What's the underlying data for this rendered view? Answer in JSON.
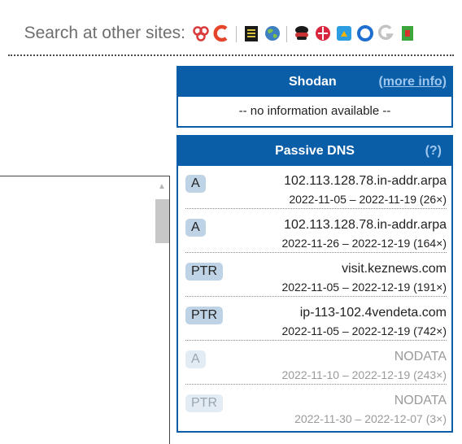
{
  "search": {
    "label": "Search at other sites:",
    "icons": [
      "chain-links-icon",
      "c-logo-icon",
      "document-icon",
      "globe-icon",
      "spy-mask-icon",
      "red-globe-icon",
      "blue-square-icon",
      "blue-ring-icon",
      "grey-g-icon",
      "green-box-icon"
    ]
  },
  "shodan": {
    "title": "Shodan",
    "more_info": "(more info)",
    "message": "-- no information available --"
  },
  "passive_dns": {
    "title": "Passive DNS",
    "help": "(?)",
    "records": [
      {
        "type": "A",
        "name": "102.113.128.78.in-addr.arpa",
        "dates": "2022-11-05 – 2022-11-19 (26×)"
      },
      {
        "type": "A",
        "name": "102.113.128.78.in-addr.arpa",
        "dates": "2022-11-26 – 2022-12-19 (164×)"
      },
      {
        "type": "PTR",
        "name": "visit.keznews.com",
        "dates": "2022-11-05 – 2022-12-19 (191×)"
      },
      {
        "type": "PTR",
        "name": "ip-113-102.4vendeta.com",
        "dates": "2022-11-05 – 2022-12-19 (742×)"
      },
      {
        "type": "A",
        "name": "NODATA",
        "dates": "2022-11-10 – 2022-12-19 (243×)"
      },
      {
        "type": "PTR",
        "name": "NODATA",
        "dates": "2022-11-30 – 2022-12-07 (3×)"
      }
    ]
  },
  "colors": {
    "header": "#0a5ea8",
    "link": "#9fc6ec",
    "badge": "#bed3e6"
  }
}
